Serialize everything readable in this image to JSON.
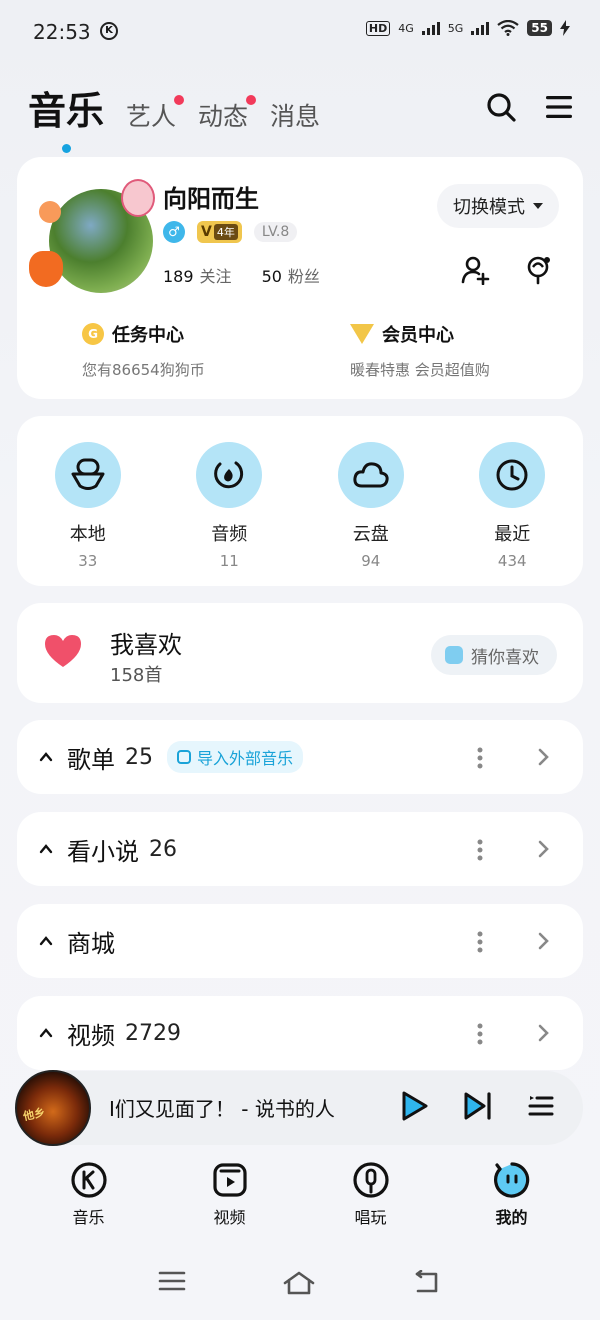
{
  "status": {
    "time": "22:53",
    "k_icon": "K",
    "hd": "HD",
    "net1": "4G",
    "net2": "5G",
    "battery": "55"
  },
  "header": {
    "tabs": [
      {
        "label": "音乐",
        "active": true
      },
      {
        "label": "艺人",
        "dot": true
      },
      {
        "label": "动态",
        "dot": true
      },
      {
        "label": "消息"
      }
    ],
    "icons": [
      "search-icon",
      "menu-icon"
    ]
  },
  "profile": {
    "name": "向阳而生",
    "gender_icon": "♂",
    "vip_years": "4年",
    "vip_letter": "V",
    "level": "LV.8",
    "following_count": "189",
    "following_label": "关注",
    "fans_count": "50",
    "fans_label": "粉丝",
    "mode_button": "切换模式",
    "task_center": {
      "title": "任务中心",
      "sub": "您有86654狗狗币",
      "coin": "G"
    },
    "member_center": {
      "title": "会员中心",
      "sub": "暖春特惠 会员超值购"
    }
  },
  "quick": [
    {
      "label": "本地",
      "count": "33",
      "icon": "local-icon"
    },
    {
      "label": "音频",
      "count": "11",
      "icon": "audio-icon"
    },
    {
      "label": "云盘",
      "count": "94",
      "icon": "cloud-icon"
    },
    {
      "label": "最近",
      "count": "434",
      "icon": "clock-icon"
    }
  ],
  "likes": {
    "title": "我喜欢",
    "count": "158首",
    "guess": "猜你喜欢"
  },
  "sections": [
    {
      "title": "歌单",
      "count": "25",
      "import": "导入外部音乐"
    },
    {
      "title": "看小说",
      "count": "26"
    },
    {
      "title": "商城",
      "count": ""
    },
    {
      "title": "视频",
      "count": "2729"
    }
  ],
  "player": {
    "track": "I们又见面了！ - 说书的人",
    "cover_text": "他乡"
  },
  "bottom_nav": [
    {
      "label": "音乐",
      "icon": "music-k-icon"
    },
    {
      "label": "视频",
      "icon": "video-icon"
    },
    {
      "label": "唱玩",
      "icon": "mic-icon"
    },
    {
      "label": "我的",
      "icon": "me-icon",
      "active": true
    }
  ],
  "colors": {
    "accent": "#16a3e0",
    "light_blue": "#b4e4f7",
    "heart": "#f0506a",
    "gold": "#f2c648"
  }
}
